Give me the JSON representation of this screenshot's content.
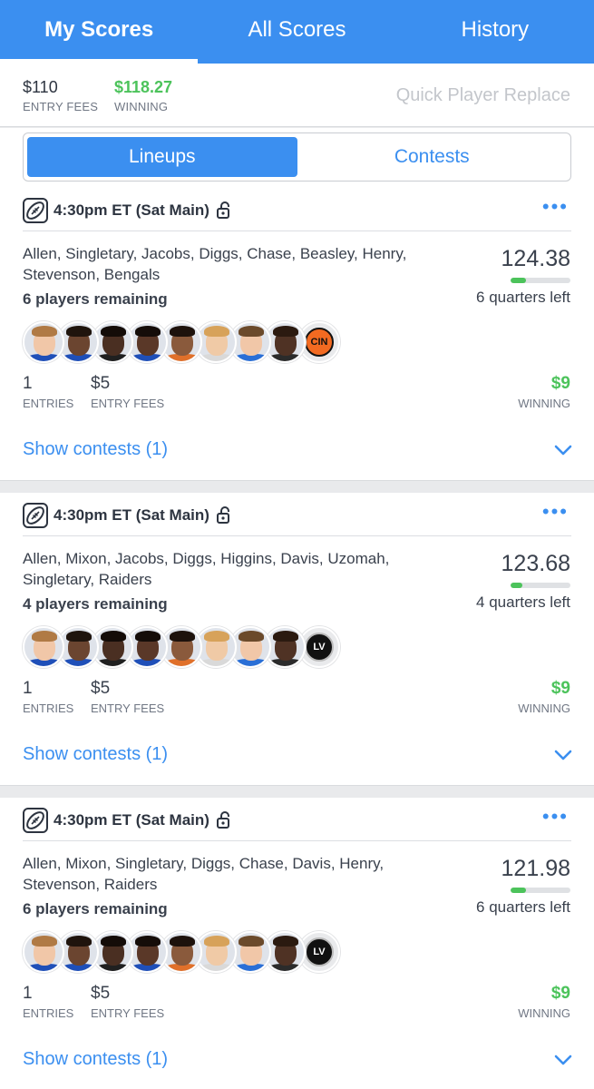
{
  "tabs": [
    {
      "label": "My Scores",
      "active": true
    },
    {
      "label": "All Scores",
      "active": false
    },
    {
      "label": "History",
      "active": false
    }
  ],
  "summary": {
    "entry_fees_value": "$110",
    "entry_fees_label": "ENTRY FEES",
    "winning_value": "$118.27",
    "winning_label": "WINNING",
    "quick_replace": "Quick Player Replace"
  },
  "segment": {
    "lineups": "Lineups",
    "contests": "Contests"
  },
  "colors": {
    "brand_blue": "#3b8ff0",
    "win_green": "#4cc35b"
  },
  "cards": [
    {
      "time": "4:30pm ET (Sat Main)",
      "names": "Allen, Singletary, Jacobs, Diggs, Chase, Beasley, Henry, Stevenson, Bengals",
      "remaining": "6 players remaining",
      "score": "124.38",
      "progress": 0.25,
      "quarters_left": "6 quarters left",
      "entries": "1",
      "entries_label": "ENTRIES",
      "fees": "$5",
      "fees_label": "ENTRY FEES",
      "winning": "$9",
      "winning_label": "WINNING",
      "show_contests": "Show contests (1)",
      "team_logo": "CIN"
    },
    {
      "time": "4:30pm ET (Sat Main)",
      "names": "Allen, Mixon, Jacobs, Diggs, Higgins, Davis, Uzomah, Singletary, Raiders",
      "remaining": "4 players remaining",
      "score": "123.68",
      "progress": 0.2,
      "quarters_left": "4 quarters left",
      "entries": "1",
      "entries_label": "ENTRIES",
      "fees": "$5",
      "fees_label": "ENTRY FEES",
      "winning": "$9",
      "winning_label": "WINNING",
      "show_contests": "Show contests (1)",
      "team_logo": "LV"
    },
    {
      "time": "4:30pm ET (Sat Main)",
      "names": "Allen, Mixon, Singletary, Diggs, Chase, Davis, Henry, Stevenson, Raiders",
      "remaining": "6 players remaining",
      "score": "121.98",
      "progress": 0.25,
      "quarters_left": "6 quarters left",
      "entries": "1",
      "entries_label": "ENTRIES",
      "fees": "$5",
      "fees_label": "ENTRY FEES",
      "winning": "$9",
      "winning_label": "WINNING",
      "show_contests": "Show contests (1)",
      "team_logo": "LV"
    }
  ]
}
